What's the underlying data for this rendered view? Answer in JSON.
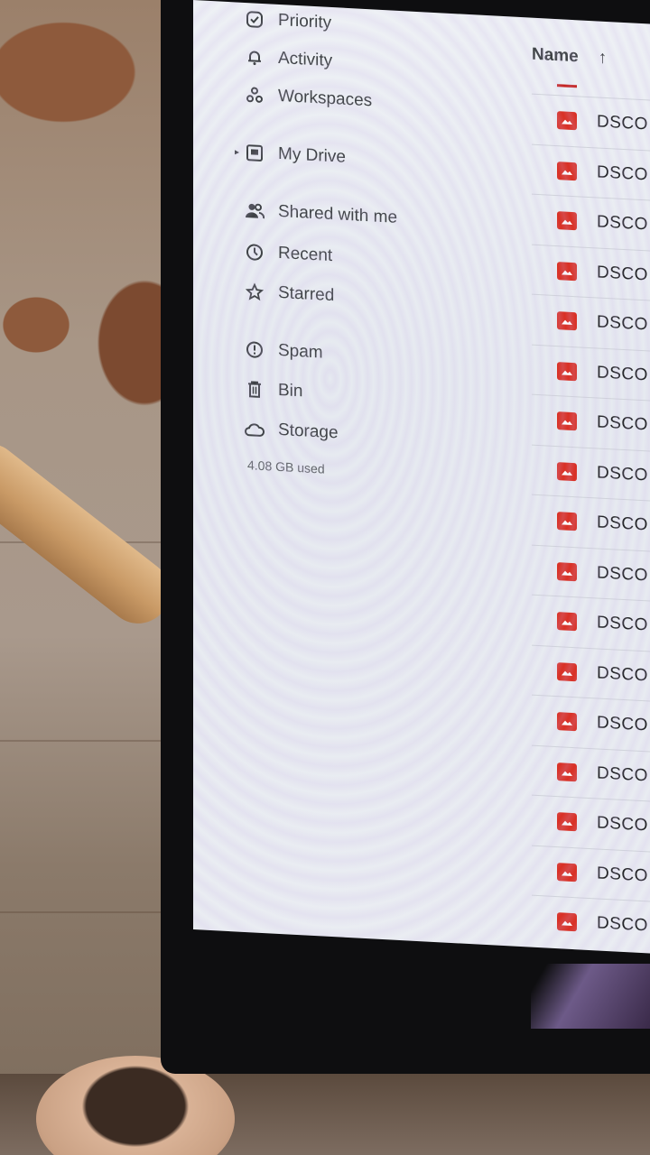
{
  "sidebar": {
    "items": [
      {
        "label": "Priority",
        "icon": "priority-icon"
      },
      {
        "label": "Activity",
        "icon": "bell-icon"
      },
      {
        "label": "Workspaces",
        "icon": "workspaces-icon"
      },
      {
        "label": "My Drive",
        "icon": "drive-icon"
      },
      {
        "label": "Shared with me",
        "icon": "people-icon"
      },
      {
        "label": "Recent",
        "icon": "clock-icon"
      },
      {
        "label": "Starred",
        "icon": "star-icon"
      },
      {
        "label": "Spam",
        "icon": "spam-icon"
      },
      {
        "label": "Bin",
        "icon": "trash-icon"
      },
      {
        "label": "Storage",
        "icon": "cloud-icon"
      }
    ],
    "storage_used": "4.08 GB used"
  },
  "filelist": {
    "column_name": "Name",
    "sort_arrow": "↑",
    "accent_color": "#d93025",
    "files": [
      "DSCO",
      "DSCO",
      "DSCO",
      "DSCO",
      "DSCO",
      "DSCO",
      "DSCO",
      "DSCO",
      "DSCO",
      "DSCO",
      "DSCO",
      "DSCO",
      "DSCO",
      "DSCO",
      "DSCO",
      "DSCO",
      "DSCO"
    ]
  }
}
